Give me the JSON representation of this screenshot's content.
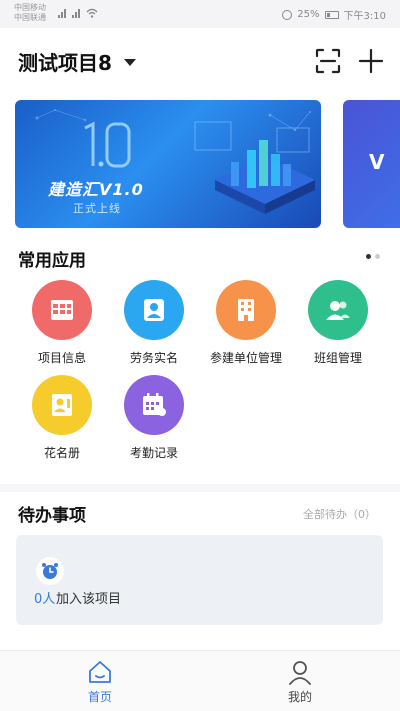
{
  "status_bar": {
    "carrier_top": "中国移动",
    "carrier_bottom": "中国联通",
    "battery": "25%",
    "time": "下午3:10"
  },
  "header": {
    "project_title": "测试项目8",
    "icons": [
      "chevron-down-icon",
      "scan-icon",
      "plus-icon"
    ]
  },
  "banner": {
    "version_mark": "1.0",
    "title": "建造汇V1.0",
    "subtitle": "正式上线",
    "next_banner_text": "V"
  },
  "common_apps": {
    "title": "常用应用",
    "pager": {
      "pages": 2,
      "active": 1
    },
    "items": [
      {
        "label": "项目信息",
        "icon": "table-icon",
        "color": "#f06a6a"
      },
      {
        "label": "劳务实名",
        "icon": "id-card-icon",
        "color": "#2ba6f0"
      },
      {
        "label": "参建单位管理",
        "icon": "building-icon",
        "color": "#f7924a"
      },
      {
        "label": "班组管理",
        "icon": "team-icon",
        "color": "#2fbf8c"
      },
      {
        "label": "花名册",
        "icon": "roster-icon",
        "color": "#f6cc2d"
      },
      {
        "label": "考勤记录",
        "icon": "calendar-icon",
        "color": "#8b63e0"
      }
    ]
  },
  "todo": {
    "title": "待办事项",
    "all_link": "全部待办（0）",
    "card": {
      "count": "0人",
      "text": "加入该项目",
      "icon": "alarm-clock-icon"
    }
  },
  "bottom_nav": {
    "items": [
      {
        "label": "首页",
        "icon": "home-icon",
        "active": true
      },
      {
        "label": "我的",
        "icon": "user-icon",
        "active": false
      }
    ]
  },
  "colors": {
    "accent": "#3a7ad9",
    "banner_blue": "#1a5ec8",
    "card_bg": "#edf1f6"
  }
}
